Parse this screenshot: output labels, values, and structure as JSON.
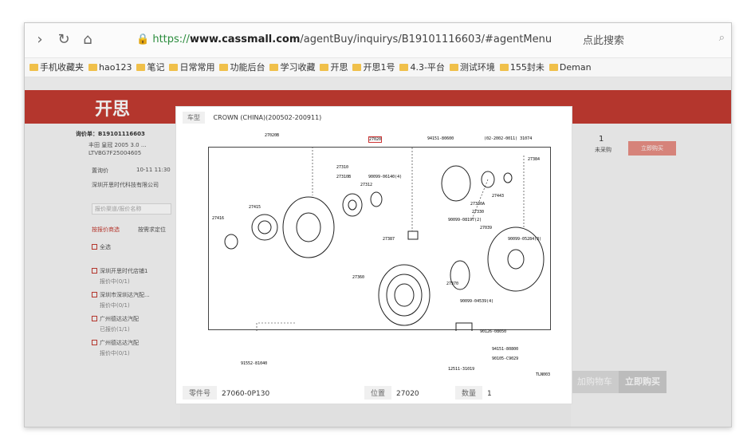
{
  "browser": {
    "url_https": "https://",
    "url_host": "www.cassmall.com",
    "url_path": "/agentBuy/inquirys/B19101116603/#agentMenu",
    "search_placeholder": "点此搜索"
  },
  "bookmarks": [
    "手机收藏夹",
    "hao123",
    "笔记",
    "日常常用",
    "功能后台",
    "学习收藏",
    "开思",
    "开思1号",
    "4.3-平台",
    "测试环境",
    "155封未",
    "Deman"
  ],
  "site": {
    "logo": "开思",
    "inquiry_no": "询价单：B19101116603",
    "car_info": "丰田 皇冠 2005 3.0 ...",
    "vin": "LTVBG7F25004605",
    "date_label": "置询价",
    "date": "10-11 11:30",
    "company": "深圳开思时代科技有限公司",
    "more": "更多",
    "search_placeholder": "报价渠道/报价名称",
    "tab_by_channel": "按报价商选",
    "tab_by_part": "按需求定位",
    "items": [
      {
        "name": "全选"
      },
      {
        "name": "深圳开思时代店铺1",
        "status": "报价中(0/1)"
      },
      {
        "name": "深圳市深圳达汽配...",
        "status": "报价中(0/1)"
      },
      {
        "name": "广州德达达汽配",
        "status": "已报价(1/1)"
      },
      {
        "name": "广州德达达汽配",
        "status": "报价中(0/1)"
      }
    ],
    "qty_count": "1",
    "qty_label": "未采购",
    "buy_all": "立即购买",
    "cart": "加购物车",
    "buy_now": "立即购买"
  },
  "modal": {
    "car_model_label": "车型",
    "car_model": "CROWN (CHINA)(200502-200911)",
    "part_no_label": "零件号",
    "part_no": "27060-0P130",
    "position_label": "位置",
    "position": "27020",
    "quantity_label": "数量",
    "quantity": "1"
  },
  "diagram_labels": [
    "27020B",
    "27020",
    "94151-80600",
    "(02-2002-0011) 31074",
    "27384",
    "27310",
    "27310B",
    "90099-06140(4)",
    "27312",
    "27443",
    "27330A",
    "27330",
    "27415",
    "27416",
    "90099-08197(2)",
    "27039",
    "90099-05284(3)",
    "27387",
    "27360",
    "27370",
    "90099-04539(4)",
    "90126-08050",
    "94151-80800",
    "90105-C9029",
    "12511-31019",
    "91552-81040",
    "TLN003"
  ]
}
